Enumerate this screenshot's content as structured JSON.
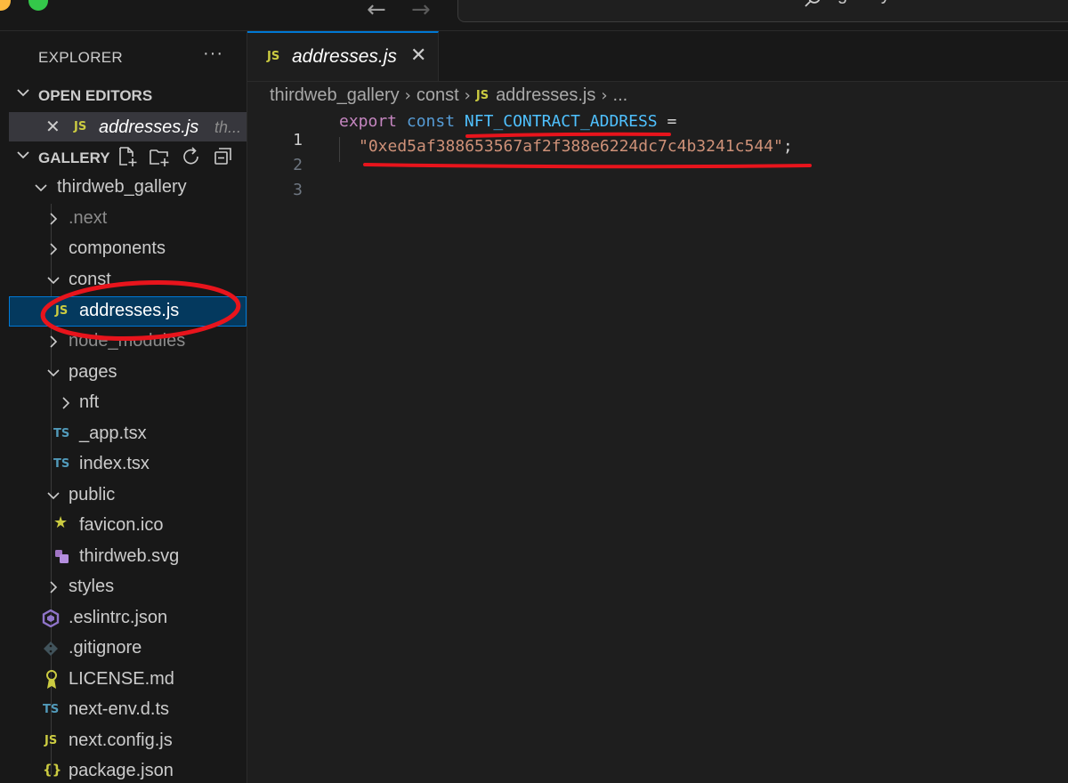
{
  "titlebar": {
    "search_text": "gallery",
    "icons": [
      "back-arrow-icon",
      "forward-arrow-icon",
      "search-icon"
    ]
  },
  "explorer": {
    "title": "EXPLORER",
    "more": "···",
    "open_editors": {
      "label": "OPEN EDITORS",
      "items": [
        {
          "icon": "JS",
          "name": "addresses.js",
          "path": "th..."
        }
      ]
    },
    "gallery": {
      "label": "GALLERY",
      "actions": [
        "new-file-icon",
        "new-folder-icon",
        "refresh-icon",
        "collapse-all-icon"
      ]
    },
    "tree": [
      {
        "label": "thirdweb_gallery",
        "kind": "folder",
        "open": true
      },
      {
        "label": ".next",
        "kind": "folder",
        "open": false
      },
      {
        "label": "components",
        "kind": "folder",
        "open": false
      },
      {
        "label": "const",
        "kind": "folder",
        "open": true
      },
      {
        "label": "addresses.js",
        "kind": "file",
        "icon": "JS",
        "selected": true
      },
      {
        "label": "node_modules",
        "kind": "folder",
        "open": false
      },
      {
        "label": "pages",
        "kind": "folder",
        "open": true
      },
      {
        "label": "nft",
        "kind": "folder",
        "open": false
      },
      {
        "label": "_app.tsx",
        "kind": "file",
        "icon": "TS"
      },
      {
        "label": "index.tsx",
        "kind": "file",
        "icon": "TS"
      },
      {
        "label": "public",
        "kind": "folder",
        "open": true
      },
      {
        "label": "favicon.ico",
        "kind": "file",
        "icon": "★"
      },
      {
        "label": "thirdweb.svg",
        "kind": "file",
        "icon": "svg"
      },
      {
        "label": "styles",
        "kind": "folder",
        "open": false
      },
      {
        "label": ".eslintrc.json",
        "kind": "file",
        "icon": "eslint"
      },
      {
        "label": ".gitignore",
        "kind": "file",
        "icon": "git"
      },
      {
        "label": "LICENSE.md",
        "kind": "file",
        "icon": "license"
      },
      {
        "label": "next-env.d.ts",
        "kind": "file",
        "icon": "TS"
      },
      {
        "label": "next.config.js",
        "kind": "file",
        "icon": "JS"
      },
      {
        "label": "package.json",
        "kind": "file",
        "icon": "{}"
      }
    ]
  },
  "editor": {
    "tab": {
      "icon": "JS",
      "name": "addresses.js"
    },
    "breadcrumb": [
      "thirdweb_gallery",
      "const",
      "addresses.js",
      "..."
    ],
    "lines": [
      {
        "no": "1",
        "kw": "export",
        "kw2": "const",
        "ident": "NFT_CONTRACT_ADDRESS",
        "rest": " ="
      },
      {
        "no": "2",
        "str": "\"0xed5af388653567af2f388e6224dc7c4b3241c544\"",
        "rest": ";"
      },
      {
        "no": "3"
      }
    ]
  },
  "colors": {
    "annotation": "#e8141c",
    "accent": "#0078d4",
    "js_icon": "#cbcb41",
    "ts_icon": "#519aba"
  }
}
